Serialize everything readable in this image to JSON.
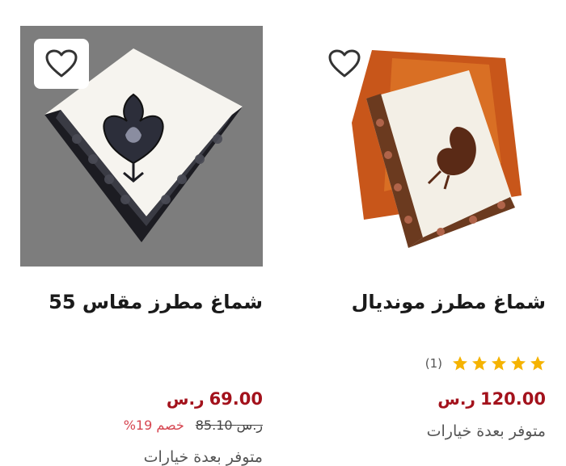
{
  "products": [
    {
      "title": "شماغ مطرز مقاس 55",
      "price": "69.00",
      "old_price": "85.10",
      "discount": "خصم 19%",
      "availability": "متوفر بعدة خيارات",
      "image_bg": "#7d7d7d"
    },
    {
      "title": "شماغ مطرز مونديال",
      "rating": 5,
      "rating_count": "(1)",
      "price": "120.00",
      "availability": "متوفر بعدة خيارات"
    }
  ],
  "currency_symbol": "ر.س",
  "colors": {
    "price": "#a3121c",
    "discount": "#d64550",
    "star": "#f5b301"
  },
  "icons": [
    "heart-icon",
    "star-icon",
    "riyal-icon"
  ]
}
